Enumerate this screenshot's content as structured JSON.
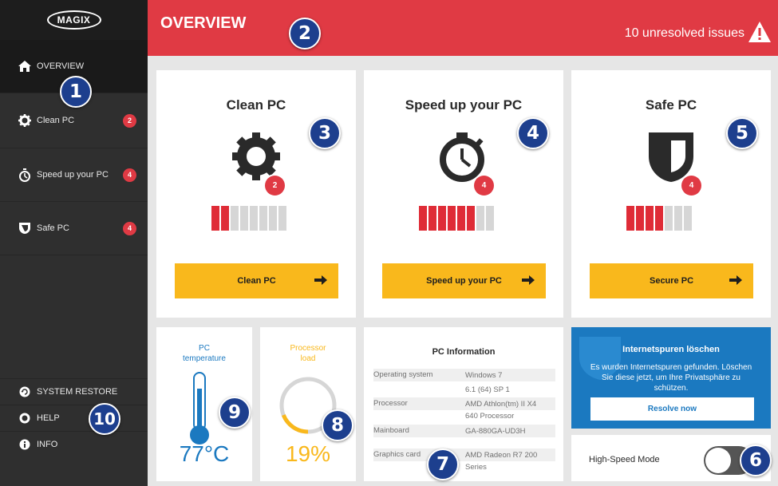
{
  "sidebar": {
    "logo": "MAGIX",
    "items": [
      {
        "label": "OVERVIEW",
        "badge": ""
      },
      {
        "label": "Clean PC",
        "badge": "2"
      },
      {
        "label": "Speed up your PC",
        "badge": "4"
      },
      {
        "label": "Safe PC",
        "badge": "4"
      }
    ],
    "bottom": [
      {
        "label": "SYSTEM RESTORE"
      },
      {
        "label": "HELP"
      },
      {
        "label": "INFO"
      }
    ]
  },
  "header": {
    "title": "OVERVIEW",
    "issues": "10 unresolved issues"
  },
  "cards": [
    {
      "title": "Clean PC",
      "badge": "2",
      "level": 2,
      "segments": 8,
      "button": "Clean PC"
    },
    {
      "title": "Speed up your PC",
      "badge": "4",
      "level": 6,
      "segments": 8,
      "button": "Speed up your PC"
    },
    {
      "title": "Safe PC",
      "badge": "4",
      "level": 4,
      "segments": 7,
      "button": "Secure PC"
    }
  ],
  "temperature": {
    "title": "PC temperature",
    "value": "77°C"
  },
  "processor": {
    "title": "Processor load",
    "value": "19%",
    "load": 0.19
  },
  "pc_info": {
    "title": "PC Information",
    "rows": [
      {
        "key": "Operating system",
        "value": "Windows 7",
        "value2": "6.1 (64) SP 1"
      },
      {
        "key": "Processor",
        "value": "AMD Athlon(tm) II X4",
        "value2": "640 Processor"
      },
      {
        "key": "Mainboard",
        "value": "GA-880GA-UD3H",
        "value2": ""
      },
      {
        "key": "Graphics card",
        "value": "AMD Radeon R7 200",
        "value2": "Series"
      }
    ]
  },
  "internet": {
    "title": "Internetspuren löschen",
    "text": "Es wurden Internetspuren gefunden. Löschen Sie diese jetzt, um Ihre Privatsphäre zu schützen.",
    "button": "Resolve now"
  },
  "high_speed": {
    "label": "High-Speed Mode",
    "on": false
  },
  "markers": [
    "1",
    "2",
    "3",
    "4",
    "5",
    "6",
    "7",
    "8",
    "9",
    "10"
  ],
  "colors": {
    "accent_red": "#e03a44",
    "accent_yellow": "#f9b81c",
    "accent_blue": "#1b79c0",
    "marker_blue": "#1d3f8e",
    "sidebar": "#2f2f2f"
  }
}
